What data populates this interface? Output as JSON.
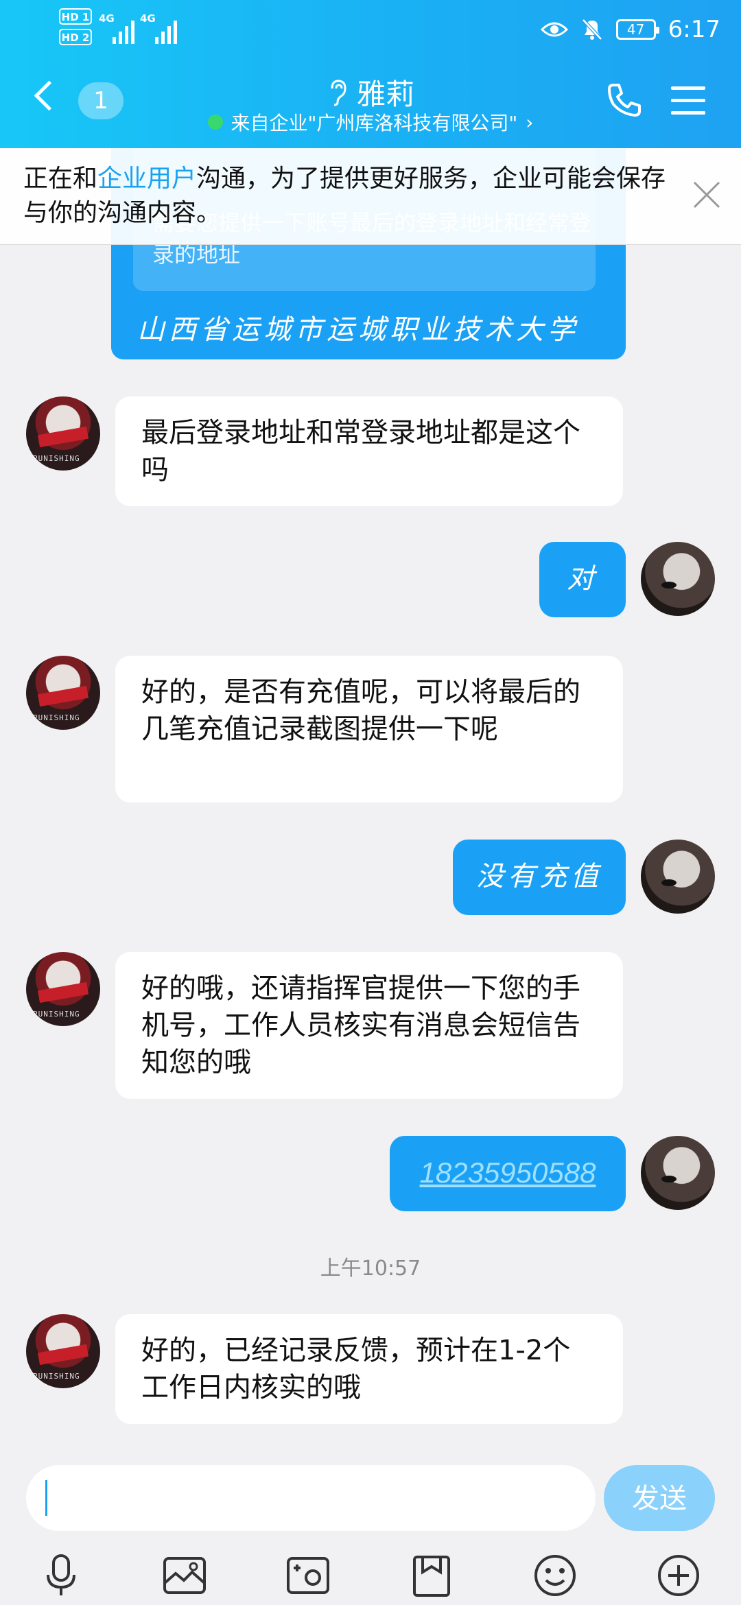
{
  "status_bar": {
    "sim1": "HD 1",
    "sim2": "HD 2",
    "net1": "4G",
    "net2": "4G",
    "battery": "47",
    "time": "6:17"
  },
  "header": {
    "unread_count": "1",
    "contact_name": "雅莉",
    "subtitle": "来自企业\"广州库洛科技有限公司\"",
    "subtitle_chevron": "›"
  },
  "notice": {
    "prefix": "正在和",
    "highlight": "企业用户",
    "suffix": "沟通，为了提供更好服务，企业可能会保存与你的沟通内容。"
  },
  "quoted_message": {
    "text": "需要您提供一下账号最后的登录地址和经常登录的地址",
    "reply": "山西省运城市运城职业技术大学"
  },
  "messages": [
    {
      "side": "left",
      "text": "最后登录地址和常登录地址都是这个吗"
    },
    {
      "side": "right",
      "text": "对"
    },
    {
      "side": "left",
      "text": "好的，是否有充值呢，可以将最后的几笔充值记录截图提供一下呢"
    },
    {
      "side": "right",
      "text": "没有充值"
    },
    {
      "side": "left",
      "text": "好的哦，还请指挥官提供一下您的手机号，工作人员核实有消息会短信告知您的哦"
    },
    {
      "side": "right",
      "text": "18235950588"
    },
    {
      "side": "left",
      "text": "好的，已经记录反馈，预计在1-2个工作日内核实的哦"
    }
  ],
  "timestamp": "上午10:57",
  "avatar_caption": "PUNISHING",
  "input": {
    "value": "",
    "send_label": "发送"
  },
  "toolbar_icons": [
    "microphone-icon",
    "image-icon",
    "camera-icon",
    "file-icon",
    "emoji-icon",
    "plus-icon"
  ],
  "colors": {
    "header_gradient_start": "#18c7f7",
    "header_gradient_end": "#1ea2f2",
    "accent": "#1aa1f6",
    "send_button": "#8ad1fb",
    "online_dot": "#39d86f",
    "background": "#f1f1f3"
  }
}
